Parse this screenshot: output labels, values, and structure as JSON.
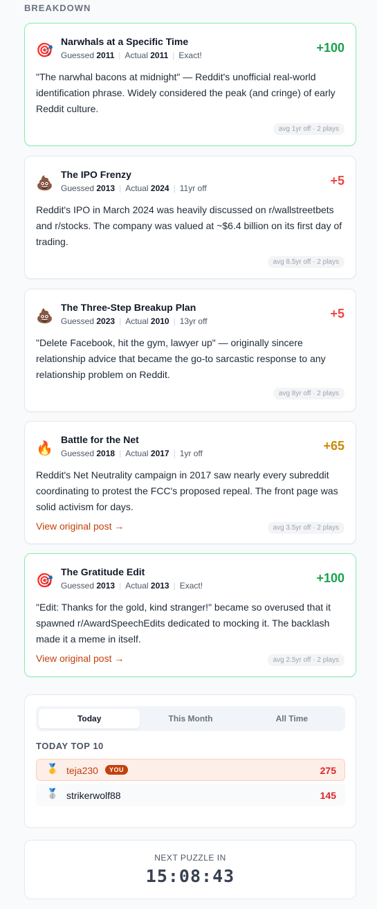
{
  "section_label": "BREAKDOWN",
  "colors": {
    "exact_border": "#86efac",
    "score_green": "#16a34a",
    "score_red": "#ef4444",
    "score_gold": "#ca8a04",
    "accent": "#c2410c"
  },
  "breakdown": [
    {
      "icon": "bullseye-icon",
      "emoji": "🎯",
      "title": "Narwhals at a Specific Time",
      "guessed_label": "Guessed",
      "guessed": "2011",
      "actual_label": "Actual",
      "actual": "2011",
      "result": "Exact!",
      "score": "+100",
      "description": "\"The narwhal bacons at midnight\" — Reddit's unofficial real-world identification phrase. Widely considered the peak (and cringe) of early Reddit culture.",
      "avg": "avg 1yr off · 2 plays",
      "link": ""
    },
    {
      "icon": "poop-icon",
      "emoji": "💩",
      "title": "The IPO Frenzy",
      "guessed_label": "Guessed",
      "guessed": "2013",
      "actual_label": "Actual",
      "actual": "2024",
      "result": "11yr off",
      "score": "+5",
      "description": "Reddit's IPO in March 2024 was heavily discussed on r/wallstreetbets and r/stocks. The company was valued at ~$6.4 billion on its first day of trading.",
      "avg": "avg 8.5yr off · 2 plays",
      "link": ""
    },
    {
      "icon": "poop-icon",
      "emoji": "💩",
      "title": "The Three-Step Breakup Plan",
      "guessed_label": "Guessed",
      "guessed": "2023",
      "actual_label": "Actual",
      "actual": "2010",
      "result": "13yr off",
      "score": "+5",
      "description": "\"Delete Facebook, hit the gym, lawyer up\" — originally sincere relationship advice that became the go-to sarcastic response to any relationship problem on Reddit.",
      "avg": "avg 8yr off · 2 plays",
      "link": ""
    },
    {
      "icon": "fire-icon",
      "emoji": "🔥",
      "title": "Battle for the Net",
      "guessed_label": "Guessed",
      "guessed": "2018",
      "actual_label": "Actual",
      "actual": "2017",
      "result": "1yr off",
      "score": "+65",
      "description": "Reddit's Net Neutrality campaign in 2017 saw nearly every subreddit coordinating to protest the FCC's proposed repeal. The front page was solid activism for days.",
      "avg": "avg 3.5yr off · 2 plays",
      "link": "View original post →"
    },
    {
      "icon": "bullseye-icon",
      "emoji": "🎯",
      "title": "The Gratitude Edit",
      "guessed_label": "Guessed",
      "guessed": "2013",
      "actual_label": "Actual",
      "actual": "2013",
      "result": "Exact!",
      "score": "+100",
      "description": "\"Edit: Thanks for the gold, kind stranger!\" became so overused that it spawned r/AwardSpeechEdits dedicated to mocking it. The backlash made it a meme in itself.",
      "avg": "avg 2.5yr off · 2 plays",
      "link": "View original post →"
    }
  ],
  "leaderboard": {
    "tabs": [
      "Today",
      "This Month",
      "All Time"
    ],
    "active_tab": "Today",
    "title": "TODAY TOP 10",
    "rows": [
      {
        "medal": "🥇",
        "icon": "gold-medal-icon",
        "name": "teja230",
        "badge": "YOU",
        "points": "275"
      },
      {
        "medal": "🥈",
        "icon": "silver-medal-icon",
        "name": "strikerwolf88",
        "badge": "",
        "points": "145"
      }
    ]
  },
  "next_puzzle": {
    "label": "NEXT PUZZLE IN",
    "countdown": "15:08:43"
  }
}
